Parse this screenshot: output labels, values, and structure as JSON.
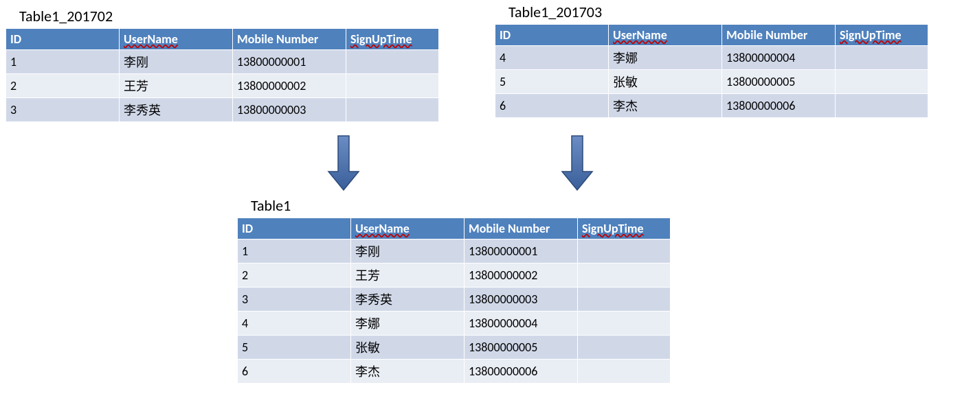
{
  "tables": {
    "left": {
      "title": "Table1_201702",
      "headers": [
        "ID",
        "UserName",
        "Mobile Number",
        "SignUpTime"
      ],
      "rows": [
        {
          "id": "1",
          "user": "李刚",
          "mobile": "13800000001",
          "signup": ""
        },
        {
          "id": "2",
          "user": "王芳",
          "mobile": "13800000002",
          "signup": ""
        },
        {
          "id": "3",
          "user": "李秀英",
          "mobile": "13800000003",
          "signup": ""
        }
      ]
    },
    "right": {
      "title": "Table1_201703",
      "headers": [
        "ID",
        "UserName",
        "Mobile Number",
        "SignUpTime"
      ],
      "rows": [
        {
          "id": "4",
          "user": "李娜",
          "mobile": "13800000004",
          "signup": ""
        },
        {
          "id": "5",
          "user": "张敏",
          "mobile": "13800000005",
          "signup": ""
        },
        {
          "id": "6",
          "user": "李杰",
          "mobile": "13800000006",
          "signup": ""
        }
      ]
    },
    "merged": {
      "title": "Table1",
      "headers": [
        "ID",
        "UserName",
        "Mobile Number",
        "SignUpTime"
      ],
      "rows": [
        {
          "id": "1",
          "user": "李刚",
          "mobile": "13800000001",
          "signup": ""
        },
        {
          "id": "2",
          "user": "王芳",
          "mobile": "13800000002",
          "signup": ""
        },
        {
          "id": "3",
          "user": "李秀英",
          "mobile": "13800000003",
          "signup": ""
        },
        {
          "id": "4",
          "user": "李娜",
          "mobile": "13800000004",
          "signup": ""
        },
        {
          "id": "5",
          "user": "张敏",
          "mobile": "13800000005",
          "signup": ""
        },
        {
          "id": "6",
          "user": "李杰",
          "mobile": "13800000006",
          "signup": ""
        }
      ]
    }
  }
}
